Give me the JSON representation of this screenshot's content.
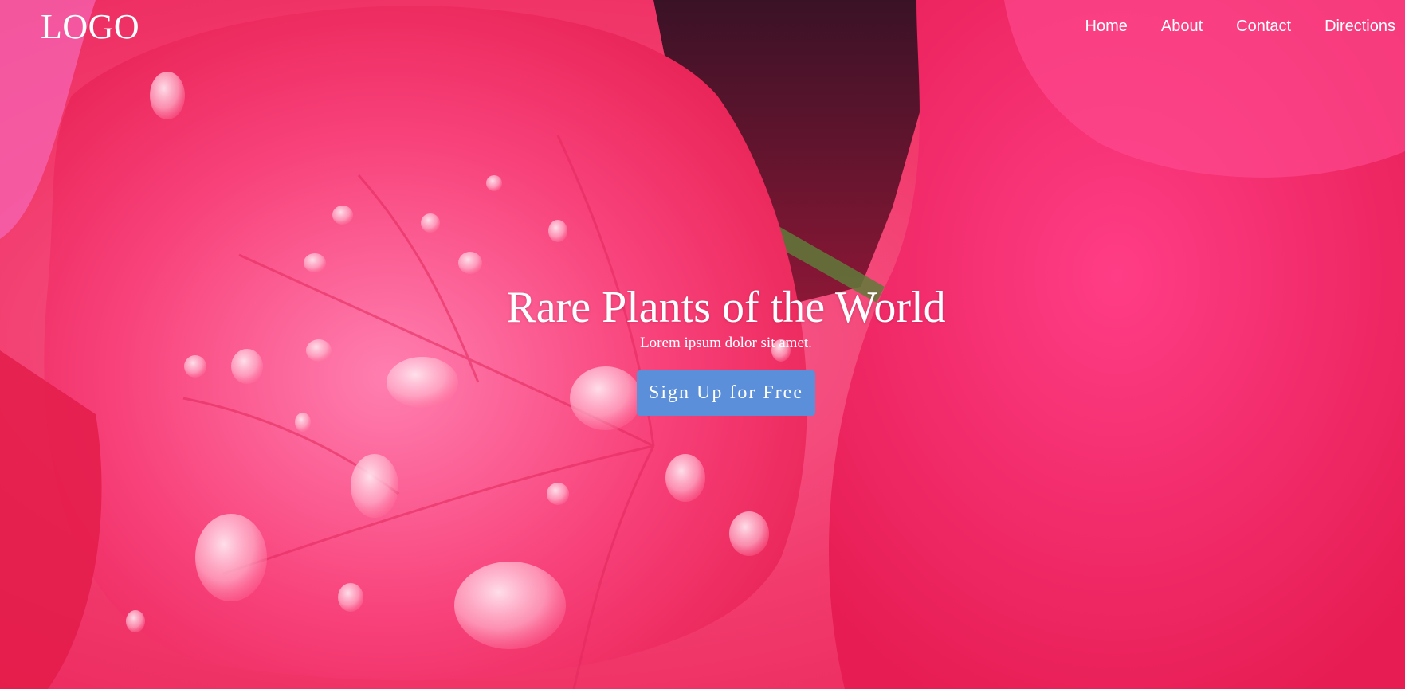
{
  "header": {
    "logo_text": "LOGO",
    "nav": [
      "Home",
      "About",
      "Contact",
      "Directions"
    ]
  },
  "hero": {
    "title": "Rare Plants of the World",
    "subtitle": "Lorem ipsum dolor sit amet.",
    "cta_label": "Sign Up for Free",
    "cta_color": "#5b8fd9",
    "background_color": "#f0255f"
  }
}
